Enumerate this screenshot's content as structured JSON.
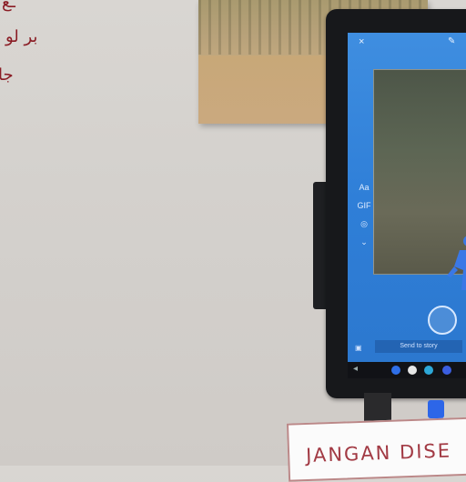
{
  "whiteboard": {
    "lines": [
      "ـع",
      "بر لو",
      "جا"
    ]
  },
  "tablet": {
    "close_icon": "×",
    "top_icon": "✎",
    "tools": [
      "Aa",
      "GIF",
      "◎",
      "⌄"
    ],
    "caption": "Send to story",
    "colors": {
      "screen": "#2f7fd8",
      "frame": "#17181b"
    }
  },
  "sign": {
    "text": "JANGAN DISE"
  }
}
